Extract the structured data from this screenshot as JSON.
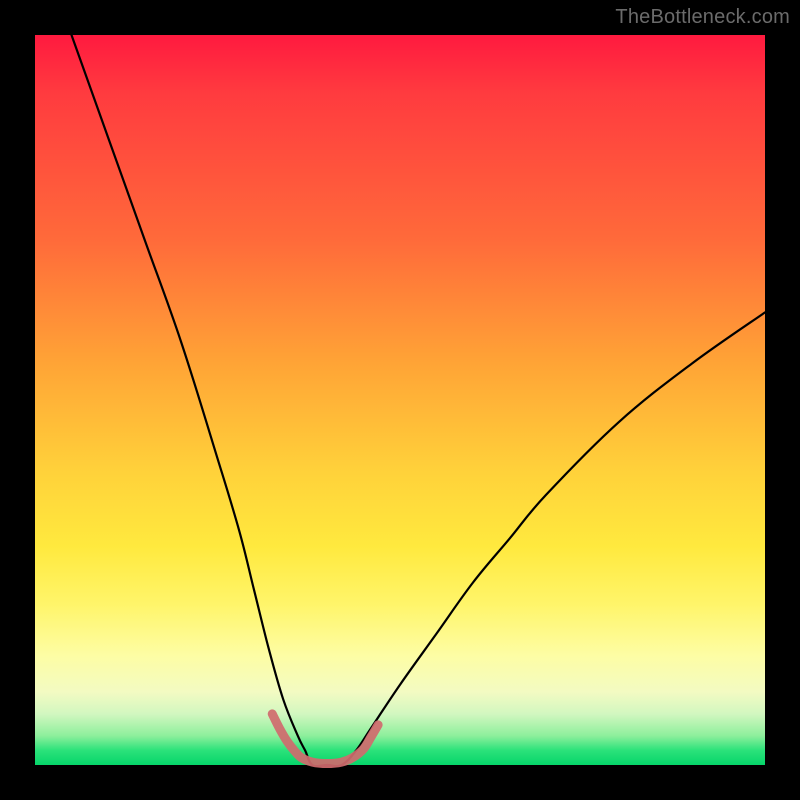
{
  "watermark": "TheBottleneck.com",
  "chart_data": {
    "type": "line",
    "title": "",
    "xlabel": "",
    "ylabel": "",
    "xlim": [
      0,
      100
    ],
    "ylim": [
      0,
      100
    ],
    "grid": false,
    "legend": false,
    "background_gradient": {
      "direction": "vertical",
      "stops": [
        {
          "pos": 0.0,
          "color": "#ff1a3f"
        },
        {
          "pos": 0.28,
          "color": "#ff6a3a"
        },
        {
          "pos": 0.6,
          "color": "#ffd23a"
        },
        {
          "pos": 0.85,
          "color": "#fdfda4"
        },
        {
          "pos": 0.96,
          "color": "#8def9c"
        },
        {
          "pos": 1.0,
          "color": "#06d56a"
        }
      ]
    },
    "series": [
      {
        "name": "bottleneck-curve",
        "color": "#000000",
        "stroke_width": 2.2,
        "x": [
          5,
          10,
          15,
          20,
          25,
          28,
          30,
          32,
          34,
          36,
          37,
          38,
          40,
          42,
          44,
          46,
          50,
          55,
          60,
          65,
          70,
          80,
          90,
          100
        ],
        "y": [
          100,
          86,
          72,
          58,
          42,
          32,
          24,
          16,
          9,
          4,
          2,
          0,
          0,
          0,
          2,
          5,
          11,
          18,
          25,
          31,
          37,
          47,
          55,
          62
        ]
      },
      {
        "name": "bottom-marker-band",
        "color": "#d06a6e",
        "stroke_width": 9,
        "x": [
          32.5,
          33.5,
          34.5,
          35.5,
          36.5,
          38.0,
          40.0,
          42.0,
          43.5,
          45.0,
          46.0,
          47.0
        ],
        "y": [
          7.0,
          5.0,
          3.3,
          2.0,
          1.0,
          0.4,
          0.2,
          0.4,
          1.0,
          2.2,
          3.8,
          5.5
        ]
      }
    ],
    "annotation": "V-shaped bottleneck curve over rainbow gradient; minimum (optimal match) around x≈38–42 at y≈0."
  }
}
